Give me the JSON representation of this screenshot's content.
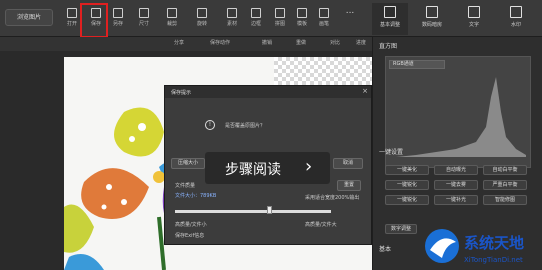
{
  "toolbar": {
    "browse_label": "浏览图片",
    "tools": [
      {
        "icon": "open-icon",
        "label": "打开"
      },
      {
        "icon": "save-icon",
        "label": "保存"
      },
      {
        "icon": "save-as-icon",
        "label": "另存"
      },
      {
        "icon": "resize-icon",
        "label": "尺寸"
      },
      {
        "icon": "crop-icon",
        "label": "裁剪"
      },
      {
        "icon": "rotate-icon",
        "label": "旋转"
      },
      {
        "icon": "material-icon",
        "label": "素材"
      },
      {
        "icon": "frame-icon",
        "label": "边框"
      },
      {
        "icon": "collage-icon",
        "label": "拼图"
      },
      {
        "icon": "template-icon",
        "label": "模板"
      },
      {
        "icon": "brush-icon",
        "label": "画笔"
      }
    ],
    "more_label": "..."
  },
  "right_tabs": [
    {
      "icon": "basic-adjust-icon",
      "label": "基本调整"
    },
    {
      "icon": "digital-darkroom-icon",
      "label": "数码暗房"
    },
    {
      "icon": "text-icon",
      "label": "文字"
    },
    {
      "icon": "add-icon",
      "label": "水印"
    }
  ],
  "row2": {
    "share": "分享",
    "save_action": "保存动作",
    "undo": "撤销",
    "redo": "重做",
    "compare": "对比",
    "progress": "进度"
  },
  "right_panel": {
    "histogram_title": "直方图",
    "histogram_select": "RGB通道",
    "oneclick_title": "一键设置",
    "buttons": [
      "一键美化",
      "自动曝光",
      "自动白平衡",
      "一键锐化",
      "一键去雾",
      "严重白平衡",
      "一键锐化",
      "一键补光",
      "智能修图"
    ],
    "digital_label": "数字调整",
    "basic_title": "基本"
  },
  "dialog": {
    "title": "保存提示",
    "close": "×",
    "warning_glyph": "!",
    "message": "是否覆盖原图片？",
    "compress_label": "压缩大小",
    "cancel_label": "取消",
    "quality_label": "文件质量",
    "file_size": "文件大小：789KB",
    "resize_label": "重置",
    "adapt_label": "采用适合宽度200%输出",
    "quality_scale": [
      "高质量/文件小",
      "高质量/文件大"
    ],
    "keep_exif": "保存Exif信息",
    "slider_level": 0.6
  },
  "banner": {
    "text": "步骤阅读",
    "chevron": "›"
  },
  "watermark": {
    "name": "系统天地",
    "url": "XiTongTianDi.net"
  }
}
